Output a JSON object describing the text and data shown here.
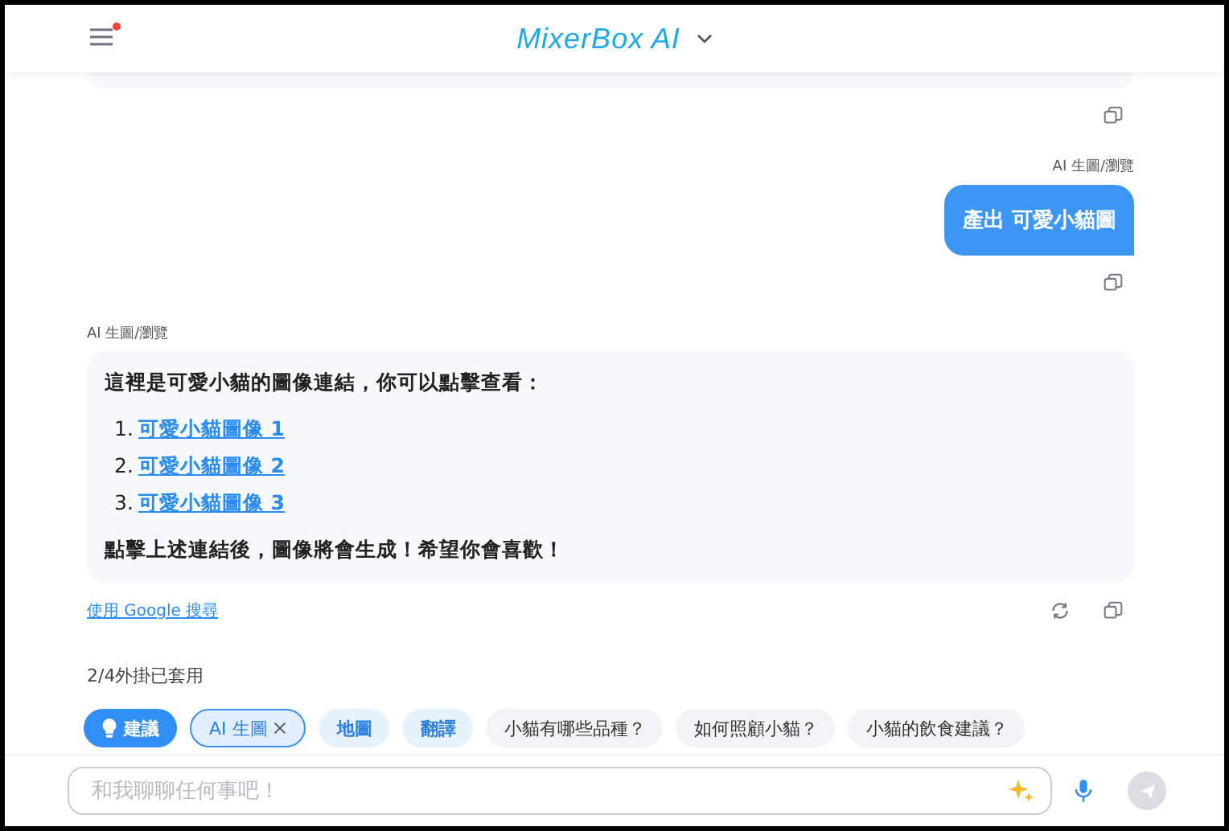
{
  "header": {
    "logo": "MixerBox AI",
    "menu_badge": true
  },
  "messages": [
    {
      "kind": "tail"
    },
    {
      "kind": "user",
      "source": "AI 生圖/瀏覽",
      "text": "產出 可愛小貓圖"
    },
    {
      "kind": "bot",
      "source": "AI 生圖/瀏覽",
      "intro": "這裡是可愛小貓的圖像連結，你可以點擊查看：",
      "links": [
        {
          "marker": "1.",
          "text": "可愛小貓圖像 1"
        },
        {
          "marker": "2.",
          "text": "可愛小貓圖像 2"
        },
        {
          "marker": "3.",
          "text": "可愛小貓圖像 3"
        }
      ],
      "outro": "點擊上述連結後，圖像將會生成！希望你會喜歡！",
      "search_link": "使用 Google 搜尋"
    }
  ],
  "plugins_status": "2/4外掛已套用",
  "chips": [
    {
      "kind": "suggest",
      "label": "建議"
    },
    {
      "kind": "plugin",
      "label": "AI 生圖",
      "selected": true
    },
    {
      "kind": "plugin",
      "label": "地圖",
      "selected": false
    },
    {
      "kind": "plugin",
      "label": "翻譯",
      "selected": false
    },
    {
      "kind": "question",
      "label": "小貓有哪些品種？"
    },
    {
      "kind": "question",
      "label": "如何照顧小貓？"
    },
    {
      "kind": "question",
      "label": "小貓的飲食建議？"
    }
  ],
  "input": {
    "placeholder": "和我聊聊任何事吧！"
  }
}
